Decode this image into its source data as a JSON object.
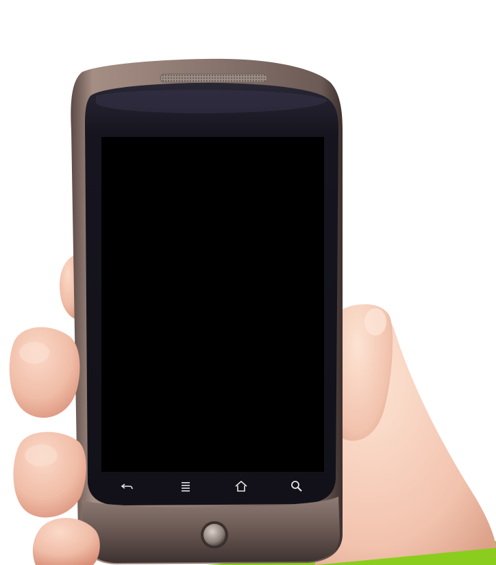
{
  "colors": {
    "background": "#ffffff",
    "accent_green": "#8bcd1e",
    "phone_body": "#7a6660",
    "phone_face": "#191823",
    "screen": "#000000",
    "skin": "#f2c3ae"
  },
  "phone": {
    "screen_state": "off",
    "softkeys": [
      {
        "name": "back-icon"
      },
      {
        "name": "menu-icon"
      },
      {
        "name": "home-icon"
      },
      {
        "name": "search-icon"
      }
    ],
    "trackball": "trackball"
  }
}
